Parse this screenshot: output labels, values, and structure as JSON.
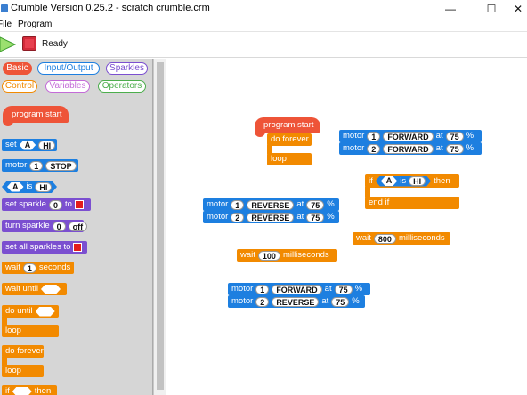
{
  "window": {
    "title": "Crumble Version 0.25.2 - scratch crumble.crm",
    "controls": {
      "minimize": "—",
      "maximize": "☐",
      "close": "✕"
    }
  },
  "menu": {
    "file": "File",
    "program": "Program"
  },
  "toolbar": {
    "status": "Ready"
  },
  "colors": {
    "blue": "#1d7fe0",
    "orange": "#f28a00",
    "red": "#ee5438",
    "purple": "#7b4fd0",
    "swatch": "#e31c1c"
  },
  "categories": {
    "basic": "Basic",
    "input_output": "Input/Output",
    "sparkles": "Sparkles",
    "control": "Control",
    "variables": "Variables",
    "operators": "Operators"
  },
  "palette": {
    "program_start": "program start",
    "set": "set",
    "set_var": "A",
    "set_val": "HI",
    "motor": "motor",
    "motor_num": "1",
    "motor_state": "STOP",
    "is_var": "A",
    "is_word": "is",
    "is_val": "HI",
    "set_sparkle": "set sparkle",
    "set_sparkle_num": "0",
    "to": "to",
    "turn_sparkle": "turn sparkle",
    "turn_sparkle_num": "0",
    "off": "off",
    "set_all_sparkles": "set all sparkles to",
    "wait": "wait",
    "wait_val": "1",
    "seconds": "seconds",
    "wait_until": "wait until",
    "do_until": "do until",
    "loop": "loop",
    "do_forever": "do forever",
    "loop2": "loop",
    "if": "if",
    "then": "then"
  },
  "canvas": {
    "program_start": "program start",
    "do_forever": "do forever",
    "loop": "loop",
    "motor_word": "motor",
    "at_word": "at",
    "percent": "%",
    "motors_a": [
      {
        "num": "1",
        "dir": "FORWARD",
        "speed": "75"
      },
      {
        "num": "2",
        "dir": "FORWARD",
        "speed": "75"
      }
    ],
    "if_block": {
      "if": "if",
      "var": "A",
      "is": "is",
      "val": "HI",
      "then": "then",
      "end": "end if"
    },
    "motors_b": [
      {
        "num": "1",
        "dir": "REVERSE",
        "speed": "75"
      },
      {
        "num": "2",
        "dir": "REVERSE",
        "speed": "75"
      }
    ],
    "wait_800": {
      "wait": "wait",
      "val": "800",
      "unit": "milliseconds"
    },
    "wait_100": {
      "wait": "wait",
      "val": "100",
      "unit": "milliseconds"
    },
    "motors_c": [
      {
        "num": "1",
        "dir": "FORWARD",
        "speed": "75"
      },
      {
        "num": "2",
        "dir": "REVERSE",
        "speed": "75"
      }
    ]
  }
}
